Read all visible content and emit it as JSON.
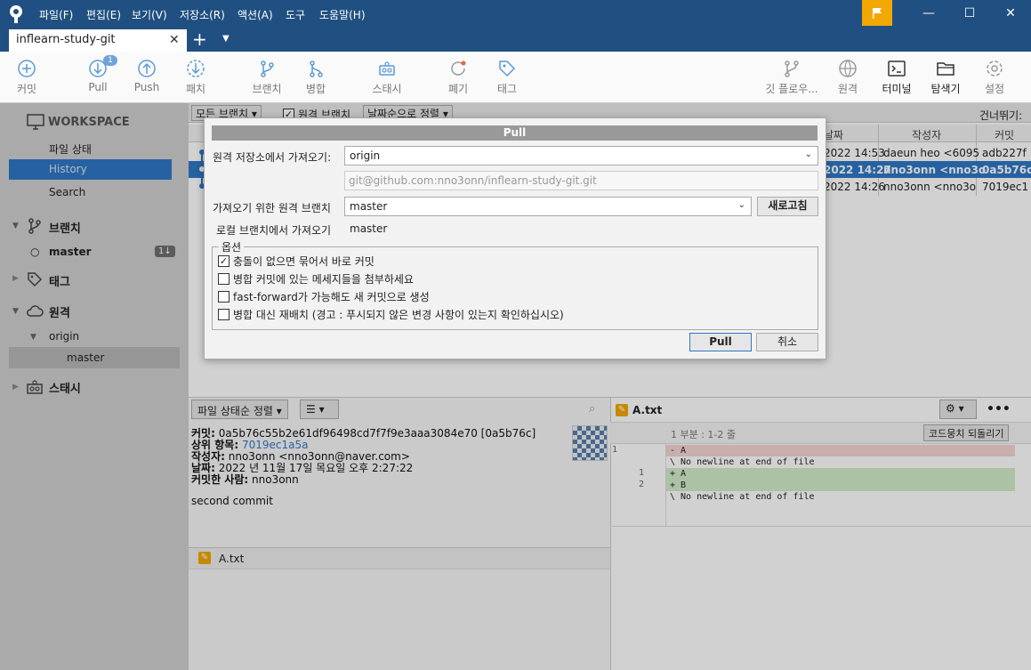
{
  "titlebar": {
    "menu": [
      "파일(F)",
      "편집(E)",
      "보기(V)",
      "저장소(R)",
      "액션(A)",
      "도구",
      "도움말(H)"
    ]
  },
  "tabs": {
    "active": "inflearn-study-git"
  },
  "toolbar": {
    "commit": "커밋",
    "pull": "Pull",
    "pull_badge": "1",
    "push": "Push",
    "fetch": "패치",
    "branch": "브랜치",
    "merge": "병합",
    "stash": "스태시",
    "discard": "폐기",
    "tag": "태그",
    "git_flow": "깃 플로우...",
    "remote": "원격",
    "terminal": "터미널",
    "explorer": "탐색기",
    "settings": "설정"
  },
  "sidebar": {
    "workspace": "WORKSPACE",
    "file_status": "파일 상태",
    "history": "History",
    "search": "Search",
    "branches": "브랜치",
    "master": "master",
    "master_badge": "1↓",
    "tags": "태그",
    "remotes": "원격",
    "origin": "origin",
    "origin_master": "master",
    "stashes": "스태시"
  },
  "history": {
    "filter_all_branches": "모든 브랜치",
    "filter_remote_branches": "원격 브랜치",
    "sort_by_date": "날짜순으로 정렬",
    "jump_to": "건너뛰기:",
    "columns": [
      "날짜",
      "작성자",
      "커밋"
    ],
    "rows": [
      {
        "date": "2022 14:53",
        "author": "daeun heo <6095",
        "commit": "adb227f"
      },
      {
        "date": "2022 14:27",
        "author": "nno3onn <nno3o",
        "commit": "0a5b76c"
      },
      {
        "date": "2022 14:26",
        "author": "nno3onn <nno3o",
        "commit": "7019ec1"
      }
    ]
  },
  "dialog": {
    "title": "Pull",
    "remote_repo_label": "원격 저장소에서 가져오기:",
    "remote_repo_value": "origin",
    "remote_url": "git@github.com:nno3onn/inflearn-study-git.git",
    "remote_branch_label": "가져오기 위한 원격 브랜치",
    "remote_branch_value": "master",
    "refresh_button": "새로고침",
    "local_branch_label": "로컬 브랜치에서 가져오기",
    "local_branch_value": "master",
    "options_legend": "옵션",
    "options": [
      {
        "label": "충돌이 없으면 묶어서 바로 커밋",
        "checked": true
      },
      {
        "label": "병합 커밋에 있는 메세지들을 첨부하세요",
        "checked": false
      },
      {
        "label": "fast-forward가 가능해도 새 커밋으로 생성",
        "checked": false
      },
      {
        "label": "병합 대신 재배치 (경고 : 푸시되지 않은 변경 사항이 있는지 확인하십시오)",
        "checked": false
      }
    ],
    "pull_button": "Pull",
    "cancel_button": "취소"
  },
  "details": {
    "sort_button": "파일 상태순 정렬",
    "commit_label": "커밋:",
    "commit_value": "0a5b76c55b2e61df96498cd7f7f9e3aaa3084e70 [0a5b76c]",
    "parent_label": "상위 항목:",
    "parent_value": "7019ec1a5a",
    "author_label": "작성자:",
    "author_value": "nno3onn <nno3onn@naver.com>",
    "date_label": "날짜:",
    "date_value": "2022 년 11월 17일 목요일 오후 2:27:22",
    "committer_label": "커밋한 사람:",
    "committer_value": "nno3onn",
    "message": "second commit",
    "file": "A.txt"
  },
  "diff": {
    "file": "A.txt",
    "hunk_header": "1 부분 : 1-2 줄",
    "revert_button": "코드뭉치 되돌리기",
    "lines": [
      {
        "old": "1",
        "new": "",
        "text": "- A",
        "type": "del"
      },
      {
        "old": "",
        "new": "",
        "text": "\\ No newline at end of file",
        "type": "ctx"
      },
      {
        "old": "",
        "new": "1",
        "text": "+ A",
        "type": "add"
      },
      {
        "old": "",
        "new": "2",
        "text": "+ B",
        "type": "add"
      },
      {
        "old": "",
        "new": "",
        "text": "\\ No newline at end of file",
        "type": "ctx"
      }
    ]
  },
  "colors": {
    "titlebar": "#205081",
    "selection": "#2f78c6",
    "flag": "#f2a800",
    "diff_add": "#d4ecc8",
    "diff_del": "#f6d5d5"
  }
}
